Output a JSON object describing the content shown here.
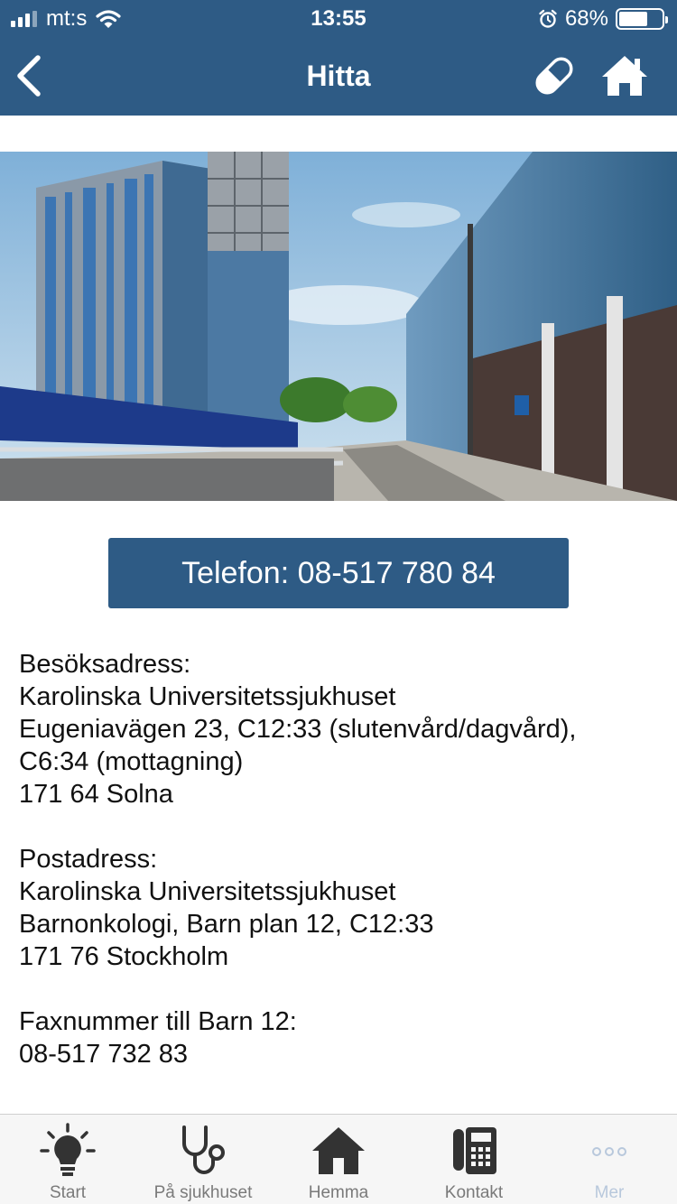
{
  "status_bar": {
    "carrier": "mt:s",
    "time": "13:55",
    "battery": "68%",
    "battery_level": 0.68
  },
  "nav": {
    "title": "Hitta",
    "back_icon": "chevron-left-icon",
    "pill_icon": "pill-icon",
    "home_icon": "home-icon"
  },
  "phone_button": {
    "label": "Telefon: 08-517 780 84"
  },
  "info": {
    "visit": {
      "heading": "Besöksadress:",
      "line1": "Karolinska Universitetssjukhuset",
      "line2": "Eugeniavägen 23, C12:33 (slutenvård/dagvård),",
      "line3": "C6:34 (mottagning)",
      "line4": "171 64 Solna"
    },
    "post": {
      "heading": "Postadress:",
      "line1": "Karolinska Universitetssjukhuset",
      "line2": "Barnonkologi, Barn plan 12, C12:33",
      "line3": "171 76 Stockholm"
    },
    "fax": {
      "heading": "Faxnummer till Barn 12:",
      "number": "08-517 732 83"
    }
  },
  "tabbar": {
    "items": [
      {
        "label": "Start",
        "icon": "lightbulb-icon"
      },
      {
        "label": "På sjukhuset",
        "icon": "stethoscope-icon"
      },
      {
        "label": "Hemma",
        "icon": "house-icon"
      },
      {
        "label": "Kontakt",
        "icon": "phone-icon"
      },
      {
        "label": "Mer",
        "icon": "more-dots-icon"
      }
    ],
    "active_color": "#b8c8dc",
    "inactive_color": "#7a7a7a"
  },
  "colors": {
    "brand": "#2e5b85",
    "background": "#ffffff"
  }
}
